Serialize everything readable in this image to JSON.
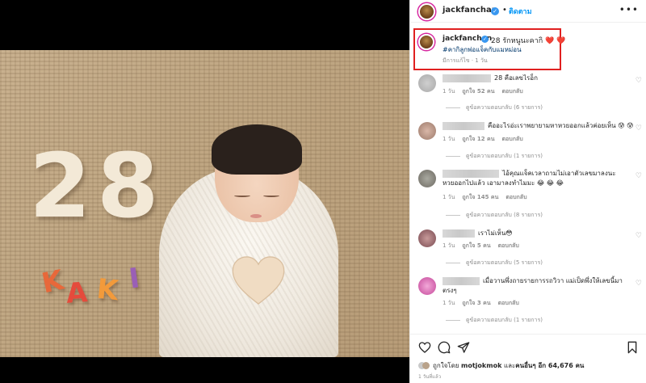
{
  "photo": {
    "number_2": "2",
    "number_8": "8",
    "letters": [
      {
        "char": "K",
        "color": "#e8683a"
      },
      {
        "char": "A",
        "color": "#e54b3c"
      },
      {
        "char": "K",
        "color": "#f29a3b"
      },
      {
        "char": "I",
        "color": "#9a5fb6"
      }
    ]
  },
  "header": {
    "username": "jackfanchan",
    "dot": "•",
    "follow_label": "ติดตาม",
    "more_label": "•••"
  },
  "caption": {
    "username": "jackfanchan",
    "text": "28 รักหนูนะคากิ",
    "hearts": "❤️ ❤️",
    "hashtag": "#คากิลูกพ่อแจ็คกับแมหม่อน",
    "meta": "มีการแก้ไข · 1 วัน",
    "highlight_color": "#e02020"
  },
  "comments": [
    {
      "text": "28 คือเลขไรอ็ก",
      "meta": [
        "1 วัน",
        "ถูกใจ 52 คน",
        "ตอบกลับ"
      ],
      "replies": "ดูข้อความตอบกลับ (6 รายการ)"
    },
    {
      "text": "คืออะไรอ่ะเราพยายามหาหวยออกแล้วค่อยเห็น 😰 😰",
      "meta": [
        "1 วัน",
        "ถูกใจ 12 คน",
        "ตอบกลับ"
      ],
      "replies": "ดูข้อความตอบกลับ (1 รายการ)"
    },
    {
      "text": "ไอ้คุณแจ็คเวลาถามไม่เอาตัวเลขมาลงนะหวยออกไปแล้ว เอามาลงทำไมมะ 😂 😂 😂",
      "meta": [
        "1 วัน",
        "ถูกใจ 145 คน",
        "ตอบกลับ"
      ],
      "replies": "ดูข้อความตอบกลับ (8 รายการ)"
    },
    {
      "text": "เราไม่เห็น😳",
      "meta": [
        "1 วัน",
        "ถูกใจ 5 คน",
        "ตอบกลับ"
      ],
      "replies": "ดูข้อความตอบกลับ (5 รายการ)"
    },
    {
      "text": "เมื่อวานพึ่งถายรายการรถวิวา แม่เป็ดพึ่งให้เลขนี้มา ตรงๆ",
      "meta": [
        "1 วัน",
        "ถูกใจ 3 คน",
        "ตอบกลับ"
      ],
      "replies": "ดูข้อความตอบกลับ (1 รายการ)"
    }
  ],
  "footer": {
    "liked_by_prefix": "ถูกใจโดย",
    "liked_by_user": "motjokmok",
    "and_label": "และ",
    "others_label": "คนอื่นๆ อีก 64,676 คน",
    "time_ago": "1 วันที่แล้ว"
  },
  "icons": {
    "like": "heart-outline-icon",
    "comment": "comment-bubble-icon",
    "share": "paper-plane-icon",
    "save": "bookmark-icon",
    "comment_like": "small-heart-icon"
  }
}
